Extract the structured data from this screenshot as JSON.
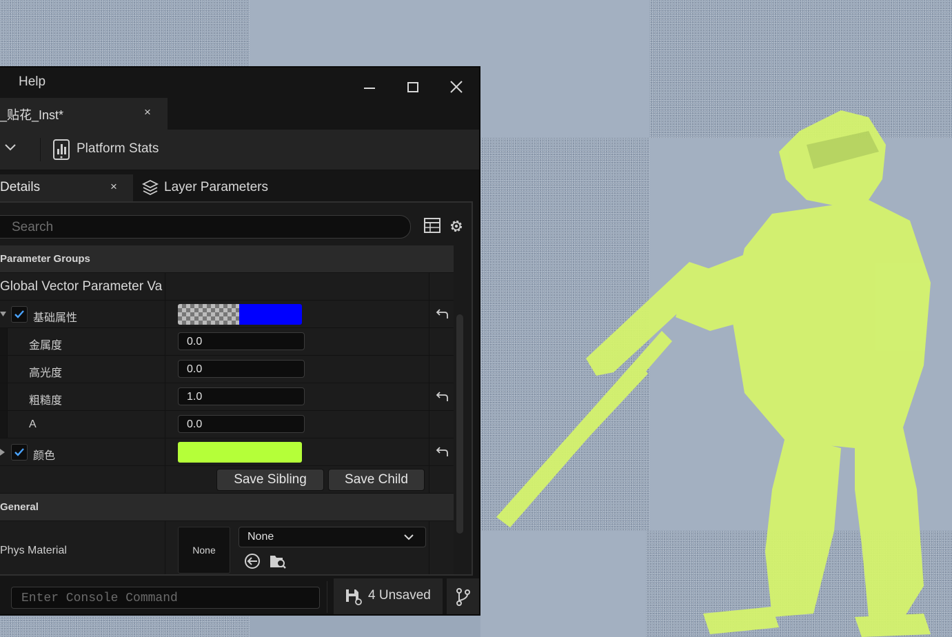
{
  "window": {
    "menu_help": "Help"
  },
  "document_tab": {
    "label": "_贴花_Inst*",
    "close": "×"
  },
  "toolbar": {
    "platform_stats_label": "Platform Stats"
  },
  "panel_tabs": {
    "details_label": "Details",
    "details_close": "×",
    "layer_parameters_label": "Layer Parameters"
  },
  "search": {
    "placeholder": "Search"
  },
  "parameter_groups": {
    "category": "Parameter Groups",
    "group_header": "Global Vector Parameter Va",
    "params": [
      {
        "name": "基础属性",
        "type": "color",
        "checked": true,
        "color": "#0000ff",
        "alpha_checker": true
      },
      {
        "name": "金属度",
        "type": "number",
        "value": "0.0"
      },
      {
        "name": "高光度",
        "type": "number",
        "value": "0.0"
      },
      {
        "name": "粗糙度",
        "type": "number",
        "value": "1.0"
      },
      {
        "name": "A",
        "type": "number",
        "value": "0.0"
      },
      {
        "name": "颜色",
        "type": "color",
        "checked": true,
        "color": "#b5ff39"
      }
    ],
    "save_sibling": "Save Sibling",
    "save_child": "Save Child"
  },
  "general": {
    "category": "General",
    "phys_material_label": "Phys Material",
    "thumb_label": "None",
    "combo_value": "None"
  },
  "statusbar": {
    "console_placeholder": "Enter Console Command",
    "unsaved_label": "4 Unsaved"
  },
  "colors": {
    "accent_check": "#4aa3ff",
    "figure_color": "#d6f56a",
    "panel_bg": "#1a1a1a"
  },
  "icons": {
    "minimize": "minimize-icon",
    "maximize": "maximize-icon",
    "close": "close-icon",
    "platform_stats": "platform-stats-icon",
    "layers": "layers-icon",
    "grid": "table-view-icon",
    "settings": "gear-icon",
    "reset": "reset-arrow-icon",
    "browse": "browse-icon",
    "use_selected": "use-selected-arrow-icon",
    "save": "save-all-icon",
    "source_control": "source-control-icon"
  }
}
